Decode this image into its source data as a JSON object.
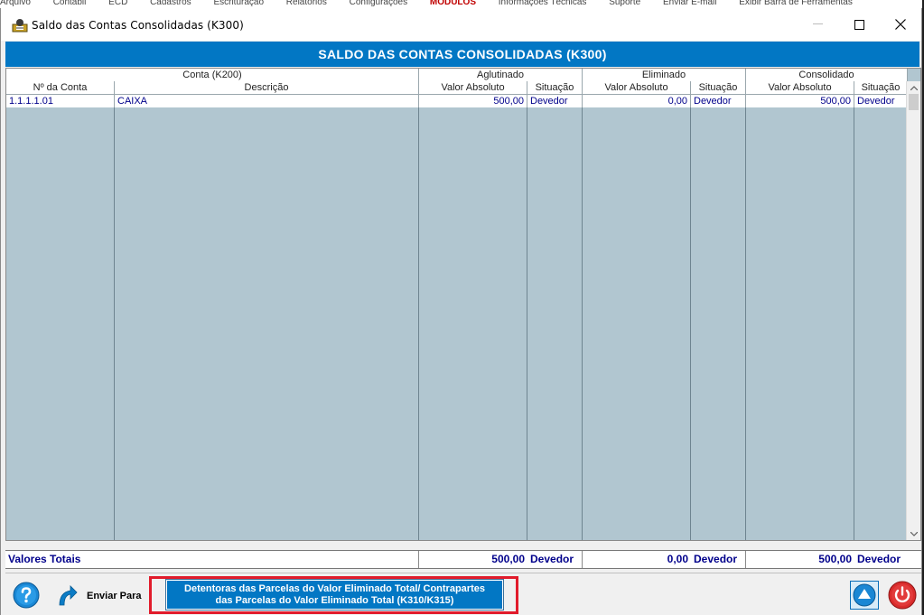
{
  "background_app": {
    "menu_fragments": [
      "Arquivo",
      "Contábil",
      "ECD",
      "Cadastros",
      "Escrituração",
      "Relatórios",
      "Configurações",
      "MÓDULOS",
      "Informações Técnicas",
      "Suporte",
      "Enviar E-mail",
      "Exibir Barra de Ferramentas"
    ]
  },
  "window": {
    "title": "Saldo das Contas Consolidadas (K300)",
    "minimize_label": "—",
    "maximize_label": "☐",
    "close_label": "✕"
  },
  "banner": {
    "title": "SALDO DAS CONTAS CONSOLIDADAS (K300)"
  },
  "grid": {
    "group_headers": {
      "conta": "Conta (K200)",
      "aglutinado": "Aglutinado",
      "eliminado": "Eliminado",
      "consolidado": "Consolidado"
    },
    "columns": [
      "Nº da Conta",
      "Descrição",
      "Valor Absoluto",
      "Situação",
      "Valor Absoluto",
      "Situação",
      "Valor Absoluto",
      "Situação"
    ],
    "rows": [
      {
        "conta": "1.1.1.1.01",
        "descricao": "CAIXA",
        "aglutinado_valor": "500,00",
        "aglutinado_situacao": "Devedor",
        "eliminado_valor": "0,00",
        "eliminado_situacao": "Devedor",
        "consolidado_valor": "500,00",
        "consolidado_situacao": "Devedor"
      }
    ]
  },
  "totals": {
    "label": "Valores Totais",
    "aglutinado_valor": "500,00",
    "aglutinado_situacao": "Devedor",
    "eliminado_valor": "0,00",
    "eliminado_situacao": "Devedor",
    "consolidado_valor": "500,00",
    "consolidado_situacao": "Devedor"
  },
  "footer": {
    "send_label": "Enviar Para",
    "detail_button_line1": "Detentoras das Parcelas  do Valor Eliminado Total/ Contrapartes",
    "detail_button_line2": "das Parcelas do Valor Eliminado Total (K310/K315)",
    "icons": {
      "help": "help-question-icon",
      "send": "curved-arrow-icon",
      "up": "arrow-up-icon",
      "power": "power-icon"
    }
  },
  "colors": {
    "accent_blue": "#0277c4",
    "grid_background": "#b1c6d0",
    "data_text": "#00008b",
    "highlight_red": "#e11b2b",
    "power_red": "#d92c2c"
  }
}
